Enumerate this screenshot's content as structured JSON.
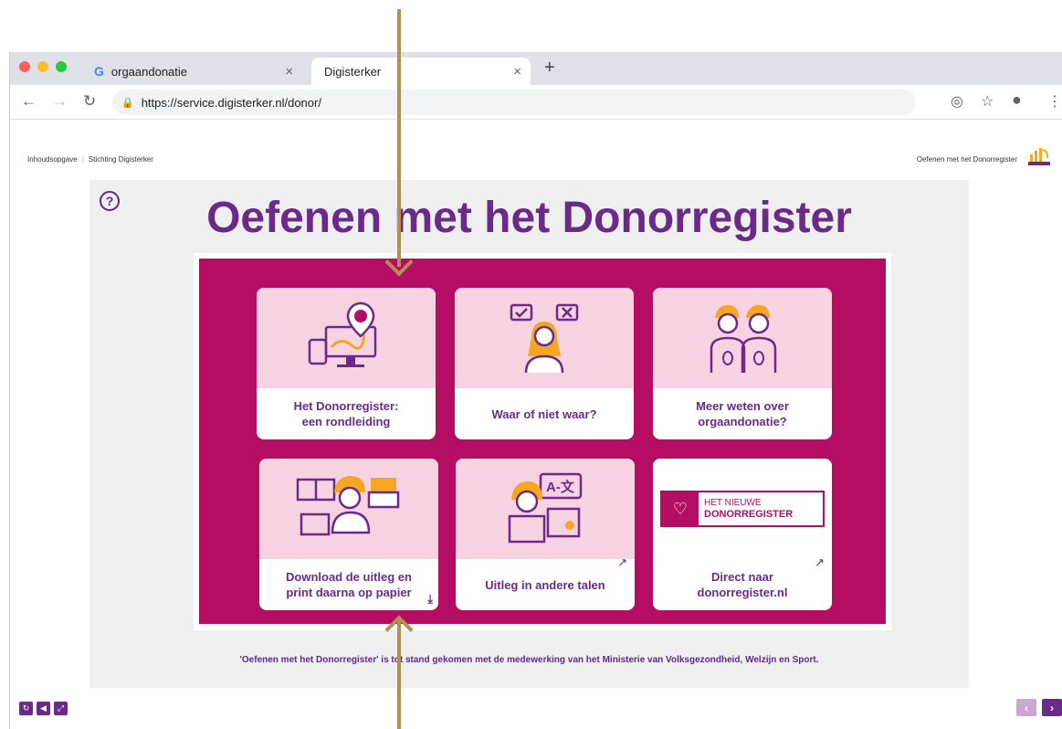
{
  "browser": {
    "tabs": [
      {
        "label": "orgaandonatie",
        "icon": "google-icon"
      },
      {
        "label": "Digisterker",
        "icon": "none"
      }
    ],
    "close_glyph": "×",
    "new_tab_glyph": "+",
    "url": "https://service.digisterker.nl/donor/",
    "traffic_light_colors": [
      "#ff5f57",
      "#febc2e",
      "#28c840"
    ]
  },
  "page": {
    "nav_left": [
      "Inhoudsopgave",
      "Stichting Digisterker"
    ],
    "nav_right": "Oefenen met het Donorregister",
    "help_glyph": "?",
    "title": "Oefenen met het Donorregister",
    "cards": [
      {
        "label": "Het Donorregister:\neen rondleiding",
        "icon": "computer-map-pin-icon",
        "external": false
      },
      {
        "label": "Waar of niet waar?",
        "icon": "person-thinking-icon",
        "external": false
      },
      {
        "label": "Meer weten over\norgaandonatie?",
        "icon": "two-people-kidneys-icon",
        "external": false
      },
      {
        "label": "Download de uitleg en\nprint daarna op papier",
        "icon": "person-printer-icon",
        "external": false,
        "download": true
      },
      {
        "label": "Uitleg in andere talen",
        "icon": "translator-icon",
        "external": true
      },
      {
        "label": "Direct naar\ndonorregister.nl",
        "icon": "het-nieuwe-donorregister-logo",
        "external": true,
        "banner": {
          "line1": "HET NIEUWE",
          "line2": "DONORREGISTER"
        }
      }
    ],
    "footer_note": "'Oefenen met het Donorregister' is tot stand gekomen met de medewerking van het Ministerie van Volksgezondheid, Welzijn en Sport.",
    "colors": {
      "accent": "#6b2a8a",
      "board": "#b40d63",
      "card_art": "#f7d3e2",
      "arrow": "#b38f50"
    }
  }
}
